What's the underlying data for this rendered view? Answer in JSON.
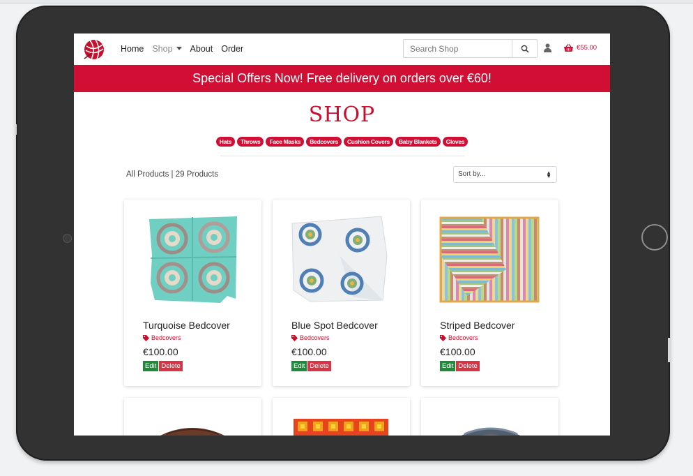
{
  "nav": {
    "links": [
      "Home",
      "Shop",
      "About",
      "Order"
    ],
    "search_placeholder": "Search Shop",
    "cart_total": "€55.00"
  },
  "banner": {
    "text": "Special Offers Now! Free delivery on orders over €60!"
  },
  "shop": {
    "title": "SHOP",
    "categories": [
      "Hats",
      "Throws",
      "Face Masks",
      "Bedcovers",
      "Cushion Covers",
      "Baby Blankets",
      "Gloves"
    ],
    "count_text": "All Products | 29 Products",
    "sort_placeholder": "Sort by..."
  },
  "products": [
    {
      "name": "Turquoise Bedcover",
      "category": "Bedcovers",
      "price": "€100.00",
      "edit": "Edit",
      "delete": "Delete"
    },
    {
      "name": "Blue Spot Bedcover",
      "category": "Bedcovers",
      "price": "€100.00",
      "edit": "Edit",
      "delete": "Delete"
    },
    {
      "name": "Striped Bedcover",
      "category": "Bedcovers",
      "price": "€100.00",
      "edit": "Edit",
      "delete": "Delete"
    }
  ],
  "colors": {
    "brand": "#d10e34",
    "edit": "#1f8a3a",
    "delete": "#d73545"
  }
}
